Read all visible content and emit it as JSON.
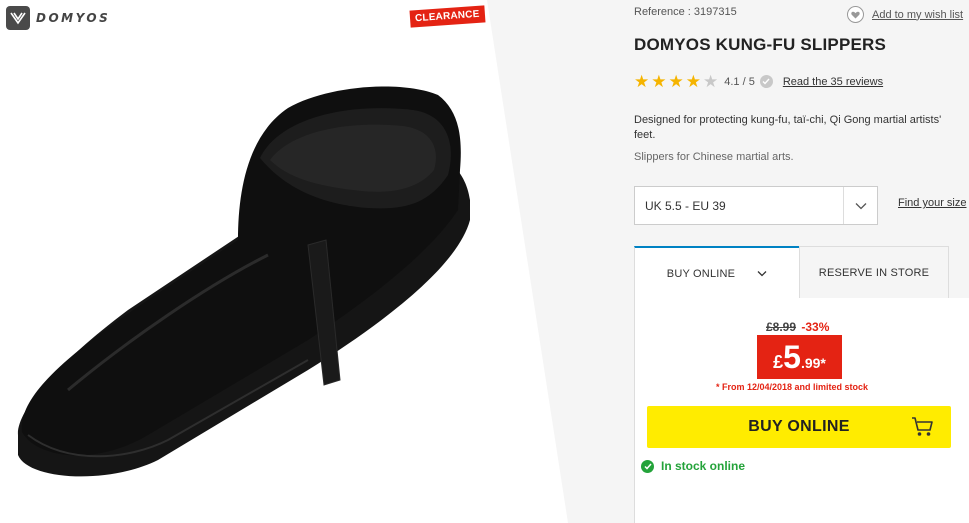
{
  "brand": {
    "name": "DOMYOS",
    "clearance_label": "CLEARANCE"
  },
  "product": {
    "reference": "Reference : 3197315",
    "title": "DOMYOS KUNG-FU SLIPPERS",
    "description": "Designed for protecting kung-fu, taï-chi, Qi Gong martial artists' feet.",
    "subdescription": "Slippers for Chinese martial arts."
  },
  "wishlist": {
    "label": "Add to my wish list",
    "icon": "heart-icon"
  },
  "rating": {
    "stars": 4,
    "max": 5,
    "value_label": "4.1 / 5",
    "reviews_label": "Read the 35 reviews"
  },
  "size": {
    "selected": "UK 5.5 - EU 39",
    "find_label": "Find your size"
  },
  "tabs": {
    "buy_online": "BUY ONLINE",
    "reserve": "RESERVE IN STORE"
  },
  "pricing": {
    "old_price": "£8.99",
    "discount": "-33%",
    "currency": "£",
    "price_int": "5",
    "price_dec": ".99*",
    "note": "* From 12/04/2018 and limited stock"
  },
  "buy": {
    "button_label": "BUY ONLINE",
    "stock_label": "In stock online"
  },
  "colors": {
    "accent_red": "#e42313",
    "button_yellow": "#ffec00",
    "stock_green": "#24a33a",
    "tab_blue": "#0082c3"
  }
}
